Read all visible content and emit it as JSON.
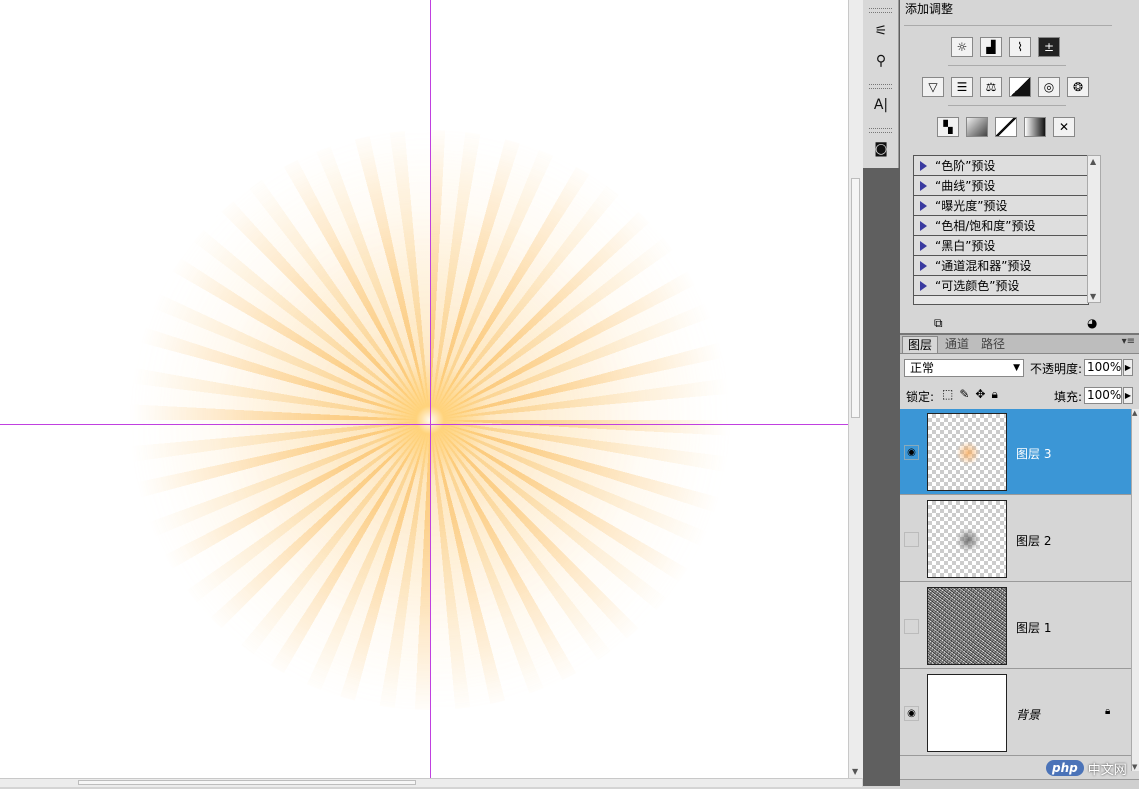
{
  "adjustments": {
    "title": "添加调整",
    "icons_row1": [
      "brightness-icon",
      "levels-icon",
      "curves-icon",
      "exposure-icon"
    ],
    "icons_row2": [
      "vibrance-icon",
      "hue-saturation-icon",
      "color-balance-icon",
      "black-white-icon",
      "photo-filter-icon",
      "channel-mixer-icon"
    ],
    "icons_row3": [
      "invert-icon",
      "posterize-icon",
      "threshold-icon",
      "gradient-map-icon",
      "selective-color-icon"
    ],
    "presets": [
      "“色阶”预设",
      "“曲线”预设",
      "“曝光度”预设",
      "“色相/饱和度”预设",
      "“黑白”预设",
      "“通道混和器”预设",
      "“可选颜色”预设"
    ]
  },
  "layers_panel": {
    "tabs": [
      "图层",
      "通道",
      "路径"
    ],
    "blend_mode": "正常",
    "opacity_label": "不透明度:",
    "opacity_value": "100%",
    "lock_label": "锁定:",
    "fill_label": "填充:",
    "fill_value": "100%",
    "layers": [
      {
        "name": "图层 3",
        "visible": true,
        "selected": true,
        "thumb": "orange-spot"
      },
      {
        "name": "图层 2",
        "visible": false,
        "selected": false,
        "thumb": "gray-spot"
      },
      {
        "name": "图层 1",
        "visible": false,
        "selected": false,
        "thumb": "noise"
      },
      {
        "name": "背景",
        "visible": true,
        "selected": false,
        "thumb": "white",
        "locked": true
      }
    ]
  },
  "watermark": {
    "logo": "php",
    "text": "中文网"
  },
  "colors": {
    "selection": "#3b96d6",
    "guide": "#c040e0",
    "burst": "#f8b24a"
  }
}
